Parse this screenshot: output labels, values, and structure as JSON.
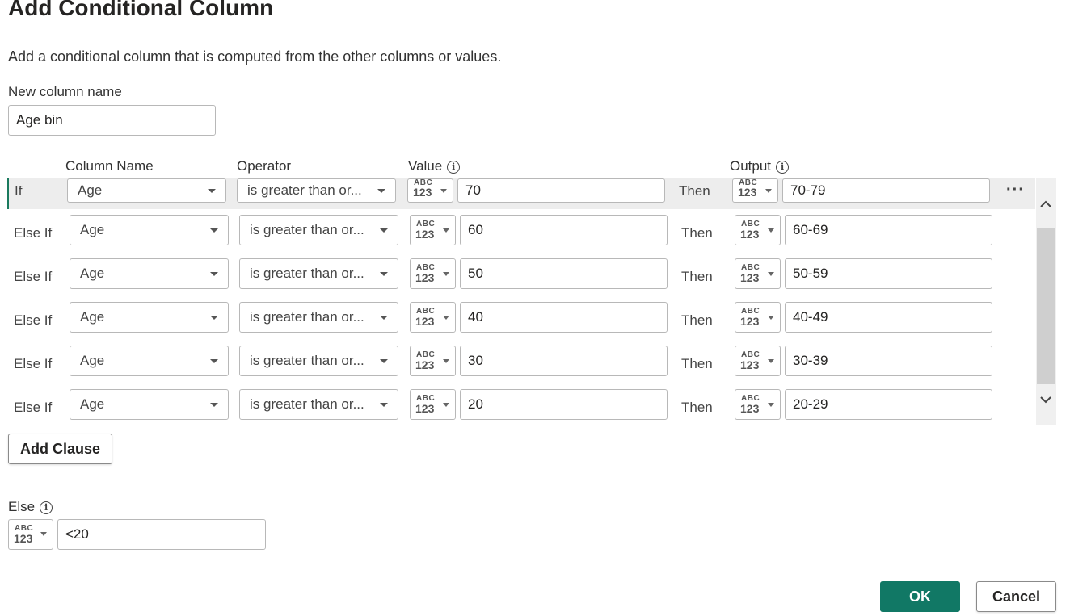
{
  "dialog": {
    "title": "Add Conditional Column",
    "subtitle": "Add a conditional column that is computed from the other columns or values."
  },
  "new_column": {
    "label": "New column name",
    "value": "Age bin"
  },
  "headers": {
    "column_name": "Column Name",
    "operator": "Operator",
    "value": "Value",
    "output": "Output"
  },
  "type_icon": {
    "abc": "ABC",
    "num": "123"
  },
  "rows": [
    {
      "keyword": "If",
      "column": "Age",
      "operator": "is greater than or...",
      "value": "70",
      "then": "Then",
      "output": "70-79"
    },
    {
      "keyword": "Else If",
      "column": "Age",
      "operator": "is greater than or...",
      "value": "60",
      "then": "Then",
      "output": "60-69"
    },
    {
      "keyword": "Else If",
      "column": "Age",
      "operator": "is greater than or...",
      "value": "50",
      "then": "Then",
      "output": "50-59"
    },
    {
      "keyword": "Else If",
      "column": "Age",
      "operator": "is greater than or...",
      "value": "40",
      "then": "Then",
      "output": "40-49"
    },
    {
      "keyword": "Else If",
      "column": "Age",
      "operator": "is greater than or...",
      "value": "30",
      "then": "Then",
      "output": "30-39"
    },
    {
      "keyword": "Else If",
      "column": "Age",
      "operator": "is greater than or...",
      "value": "20",
      "then": "Then",
      "output": "20-29"
    }
  ],
  "add_clause_label": "Add Clause",
  "else_section": {
    "label": "Else",
    "value": "<20"
  },
  "more_label": "···",
  "buttons": {
    "ok": "OK",
    "cancel": "Cancel"
  },
  "colors": {
    "accent": "#117865",
    "active_row_bg": "#ededed"
  }
}
